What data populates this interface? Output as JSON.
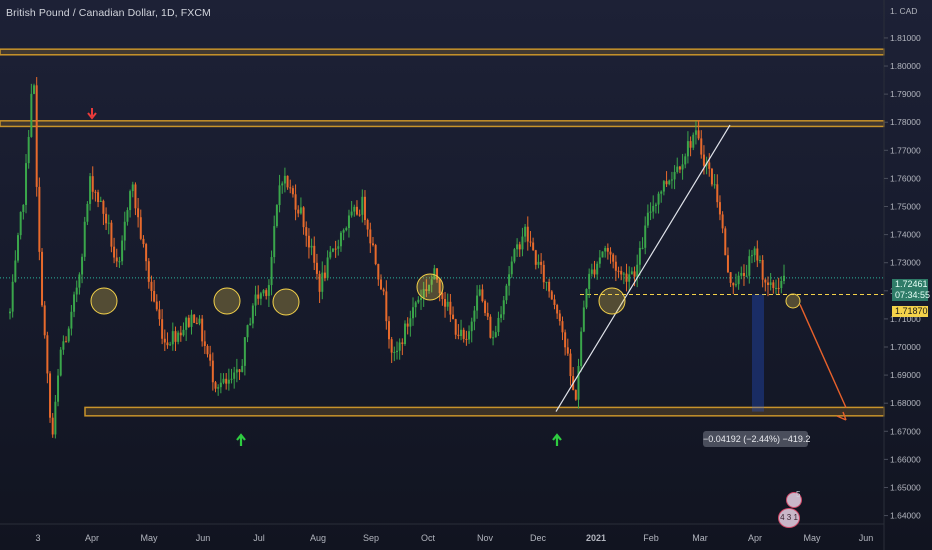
{
  "chart_title": "British Pound / Canadian Dollar, 1D, FXCM",
  "currency_label": "1. CAD",
  "chart_data": {
    "type": "candlestick",
    "title": "British Pound / Canadian Dollar, 1D, FXCM",
    "ylim": [
      1.637,
      1.8235
    ],
    "grid": false,
    "y_ticks": [
      "1.64000",
      "1.65000",
      "1.66000",
      "1.67000",
      "1.68000",
      "1.69000",
      "1.70000",
      "1.71000",
      "1.72000",
      "1.73000",
      "1.74000",
      "1.75000",
      "1.76000",
      "1.77000",
      "1.78000",
      "1.79000",
      "1.80000",
      "1.81000"
    ],
    "x_ticks": [
      "3",
      "Apr",
      "May",
      "Jun",
      "Jul",
      "Aug",
      "Sep",
      "Oct",
      "Nov",
      "Dec",
      "2021",
      "Feb",
      "Mar",
      "Apr",
      "May",
      "Jun"
    ],
    "colors": {
      "up": "#3aa64b",
      "down": "#e86a2c",
      "zone": "#c8932a",
      "price_line": "#2bb59a",
      "level_line": "#f4d24a",
      "trendline": "#e0e3ea",
      "projection": "#e8612b",
      "bull_arrow": "#2ecc40",
      "bear_arrow": "#e83a3a",
      "circle": "#f4d24a"
    },
    "horizontal_zones": [
      [
        1.804,
        1.806
      ],
      [
        1.7785,
        1.7805
      ],
      [
        1.6755,
        1.6785
      ]
    ],
    "close_price": 1.72461,
    "close_price_label": "1.72461",
    "countdown": "07:34:55",
    "level_price": 1.7187,
    "level_label": "1.71870",
    "measure_label": "−0.04192 (−2.44%) −419.2",
    "projection": {
      "from": 1.7187,
      "to": 1.677
    },
    "badge_count_top": "5",
    "badge_count_bottom": "4 3 1"
  },
  "icons": [
    "down-arrow-icon",
    "up-arrow-icon",
    "up-arrow-icon",
    "event-badge-icon",
    "event-badge-icon"
  ]
}
